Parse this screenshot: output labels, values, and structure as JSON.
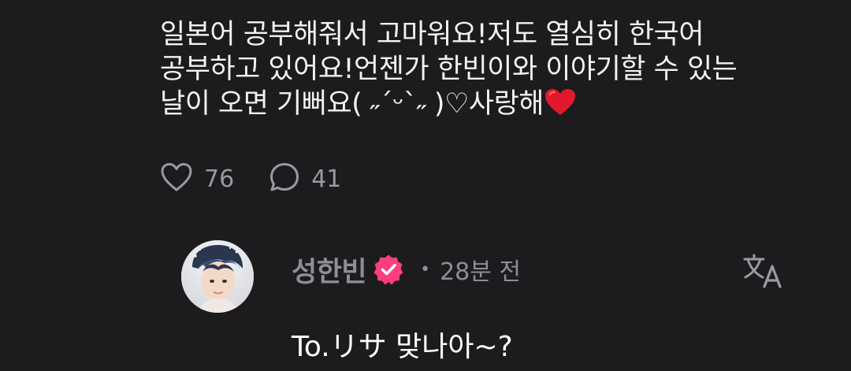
{
  "post": {
    "lines": [
      "일본어 공부해줘서 고마워요!저도 열심히 한국어",
      "공부하고 있어요!언젠가 한빈이와 이야기할 수 있는",
      "날이 오면 기뻐요( ˶ˊᵕˋ˶ )♡사랑해"
    ],
    "emoji": "red-heart-emoji"
  },
  "actions": {
    "likes": "76",
    "comments": "41",
    "like_icon": "heart-outline-icon",
    "comment_icon": "speech-bubble-icon"
  },
  "reply": {
    "author": "성한빈",
    "verified_icon": "verified-badge-icon",
    "separator": "•",
    "time": "28분 전",
    "text": "To.リサ 맞나아~?",
    "translate_icon": "translate-icon"
  },
  "colors": {
    "background": "#1c1c1e",
    "text": "#f2f2f2",
    "muted": "#8e8e93",
    "verified": "#ff3d7f",
    "heart": "#e0192d"
  }
}
